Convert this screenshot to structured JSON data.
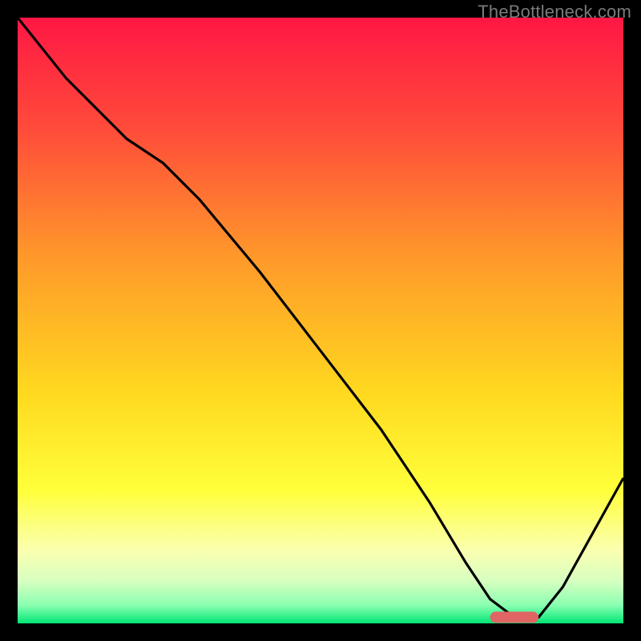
{
  "attribution": "TheBottleneck.com",
  "colors": {
    "frame": "#000000",
    "curve": "#000000",
    "marker_fill": "#e06464",
    "marker_rounded": true,
    "gradient_stops": [
      {
        "pct": 0,
        "color": "#ff1744"
      },
      {
        "pct": 18,
        "color": "#ff4a3a"
      },
      {
        "pct": 40,
        "color": "#ff9a2a"
      },
      {
        "pct": 62,
        "color": "#ffd91f"
      },
      {
        "pct": 78,
        "color": "#ffff3a"
      },
      {
        "pct": 88,
        "color": "#faffb0"
      },
      {
        "pct": 93,
        "color": "#d7ffc0"
      },
      {
        "pct": 97,
        "color": "#8affb0"
      },
      {
        "pct": 100,
        "color": "#00e676"
      }
    ]
  },
  "chart_data": {
    "type": "line",
    "title": "",
    "xlabel": "",
    "ylabel": "",
    "xlim": [
      0,
      100
    ],
    "ylim": [
      0,
      100
    ],
    "grid": false,
    "legend": false,
    "series": [
      {
        "name": "bottleneck-curve",
        "x": [
          0,
          8,
          18,
          24,
          30,
          40,
          50,
          60,
          68,
          74,
          78,
          82,
          86,
          90,
          100
        ],
        "y": [
          100,
          90,
          80,
          76,
          70,
          58,
          45,
          32,
          20,
          10,
          4,
          1,
          1,
          6,
          24
        ]
      }
    ],
    "annotations": [
      {
        "name": "optimal-range-marker",
        "shape": "rounded-rect",
        "x0": 78,
        "x1": 86,
        "y": 1
      }
    ]
  }
}
